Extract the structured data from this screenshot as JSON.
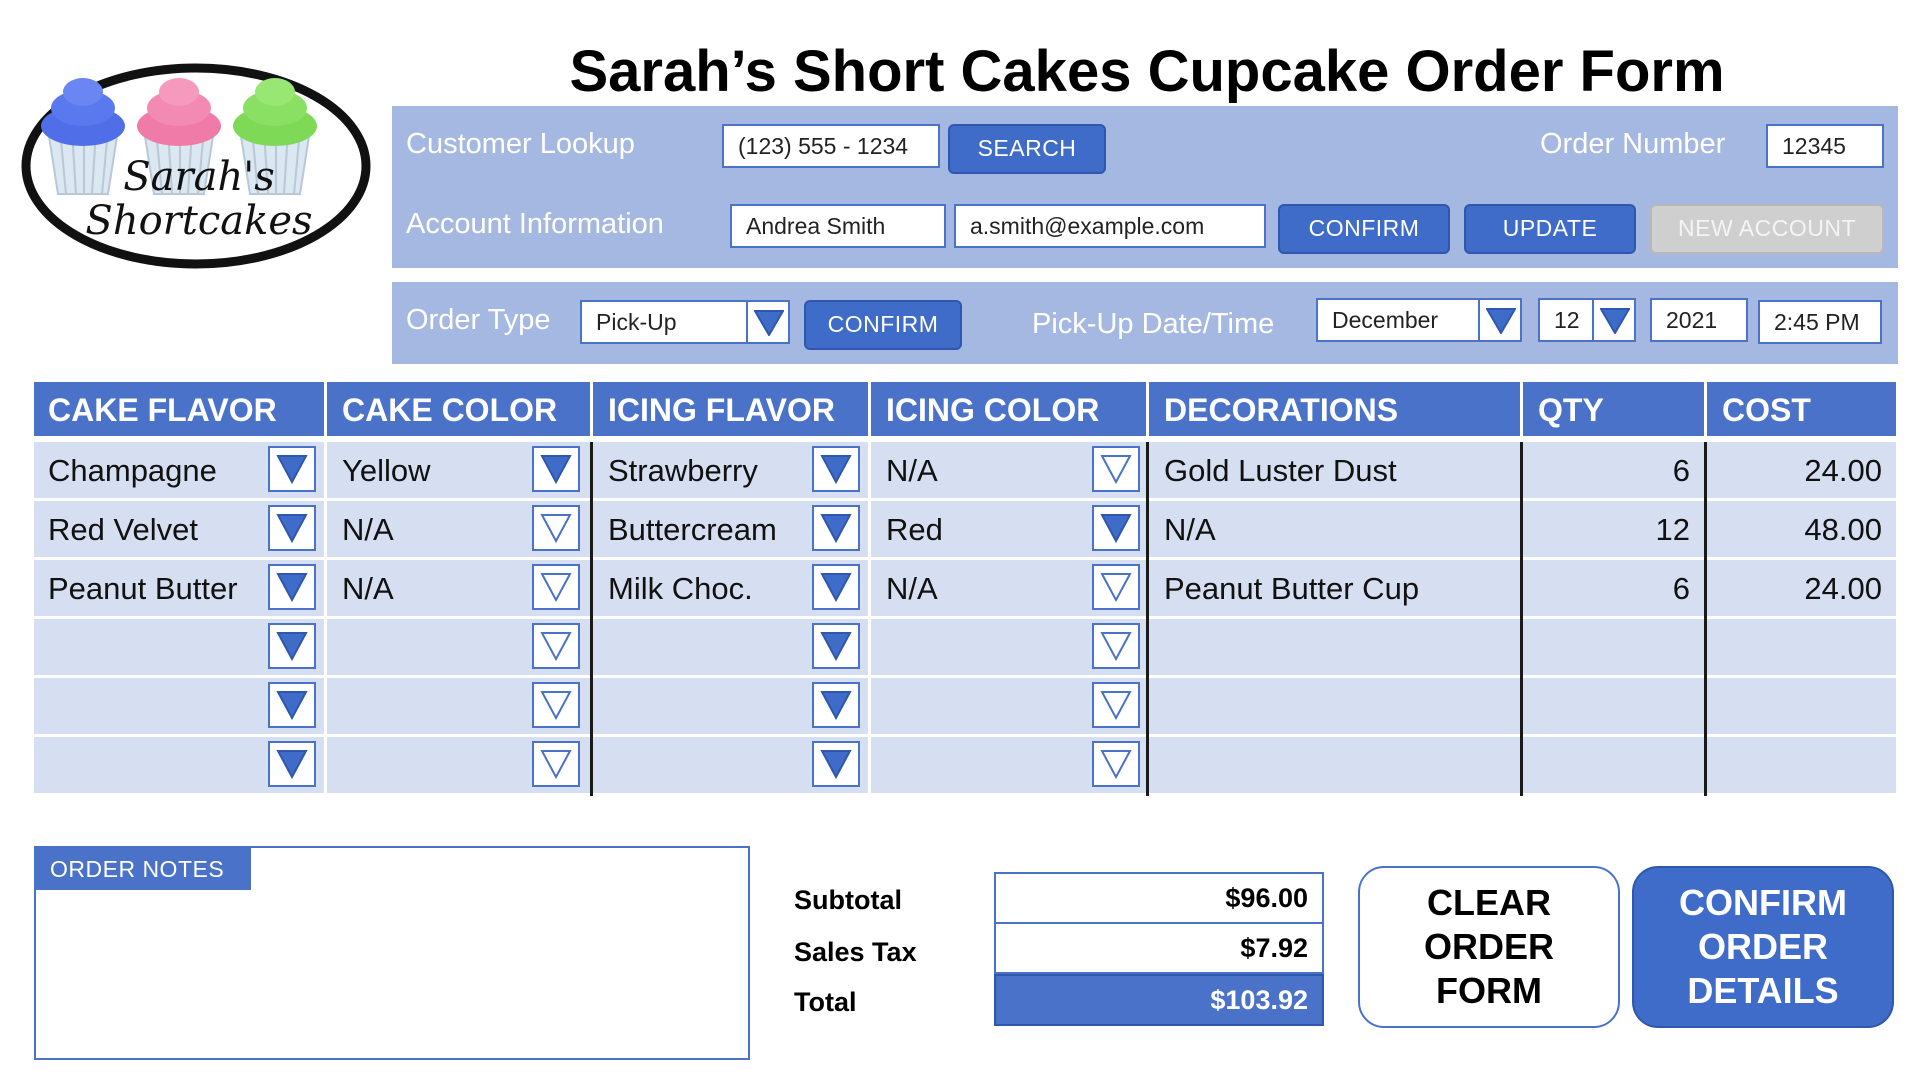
{
  "logo": {
    "line1": "Sarah's",
    "line2": "Shortcakes"
  },
  "title": "Sarah’s Short Cakes Cupcake Order Form",
  "customer": {
    "lookup_label": "Customer Lookup",
    "phone": "(123) 555 - 1234",
    "search_label": "SEARCH",
    "order_number_label": "Order Number",
    "order_number": "12345",
    "account_label": "Account Information",
    "name": "Andrea Smith",
    "email": "a.smith@example.com",
    "confirm_label": "CONFIRM",
    "update_label": "UPDATE",
    "new_account_label": "NEW ACCOUNT"
  },
  "order": {
    "type_label": "Order Type",
    "type_value": "Pick-Up",
    "confirm_label": "CONFIRM",
    "datetime_label": "Pick-Up Date/Time",
    "month": "December",
    "day": "12",
    "year": "2021",
    "time": "2:45 PM"
  },
  "table": {
    "headers": [
      "CAKE FLAVOR",
      "CAKE COLOR",
      "ICING FLAVOR",
      "ICING COLOR",
      "DECORATIONS",
      "QTY",
      "COST"
    ],
    "rows": [
      {
        "cake_flavor": "Champagne",
        "cake_color": "Yellow",
        "icing_flavor": "Strawberry",
        "icing_color": "N/A",
        "decorations": "Gold Luster Dust",
        "qty": "6",
        "cost": "24.00"
      },
      {
        "cake_flavor": "Red Velvet",
        "cake_color": "N/A",
        "icing_flavor": "Buttercream",
        "icing_color": "Red",
        "decorations": "N/A",
        "qty": "12",
        "cost": "48.00"
      },
      {
        "cake_flavor": "Peanut Butter",
        "cake_color": "N/A",
        "icing_flavor": "Milk Choc.",
        "icing_color": "N/A",
        "decorations": "Peanut Butter Cup",
        "qty": "6",
        "cost": "24.00"
      },
      {
        "cake_flavor": "",
        "cake_color": "",
        "icing_flavor": "",
        "icing_color": "",
        "decorations": "",
        "qty": "",
        "cost": ""
      },
      {
        "cake_flavor": "",
        "cake_color": "",
        "icing_flavor": "",
        "icing_color": "",
        "decorations": "",
        "qty": "",
        "cost": ""
      },
      {
        "cake_flavor": "",
        "cake_color": "",
        "icing_flavor": "",
        "icing_color": "",
        "decorations": "",
        "qty": "",
        "cost": ""
      }
    ],
    "dropdown_active": [
      [
        true,
        true,
        true,
        false
      ],
      [
        true,
        false,
        true,
        true
      ],
      [
        true,
        false,
        true,
        false
      ],
      [
        true,
        false,
        true,
        false
      ],
      [
        true,
        false,
        true,
        false
      ],
      [
        true,
        false,
        true,
        false
      ]
    ]
  },
  "notes": {
    "label": "ORDER NOTES"
  },
  "totals": {
    "subtotal_label": "Subtotal",
    "subtotal": "$96.00",
    "tax_label": "Sales Tax",
    "tax": "$7.92",
    "total_label": "Total",
    "total": "$103.92"
  },
  "actions": {
    "clear_label": "CLEAR ORDER FORM",
    "confirm_label": "CONFIRM ORDER DETAILS"
  },
  "colors": {
    "accent": "#4a72c8",
    "panel": "#a4b8e2",
    "row": "#d6def1",
    "cupcake_blue": "#4f6ee8",
    "cupcake_pink": "#f07aa8",
    "cupcake_green": "#7ed957"
  }
}
